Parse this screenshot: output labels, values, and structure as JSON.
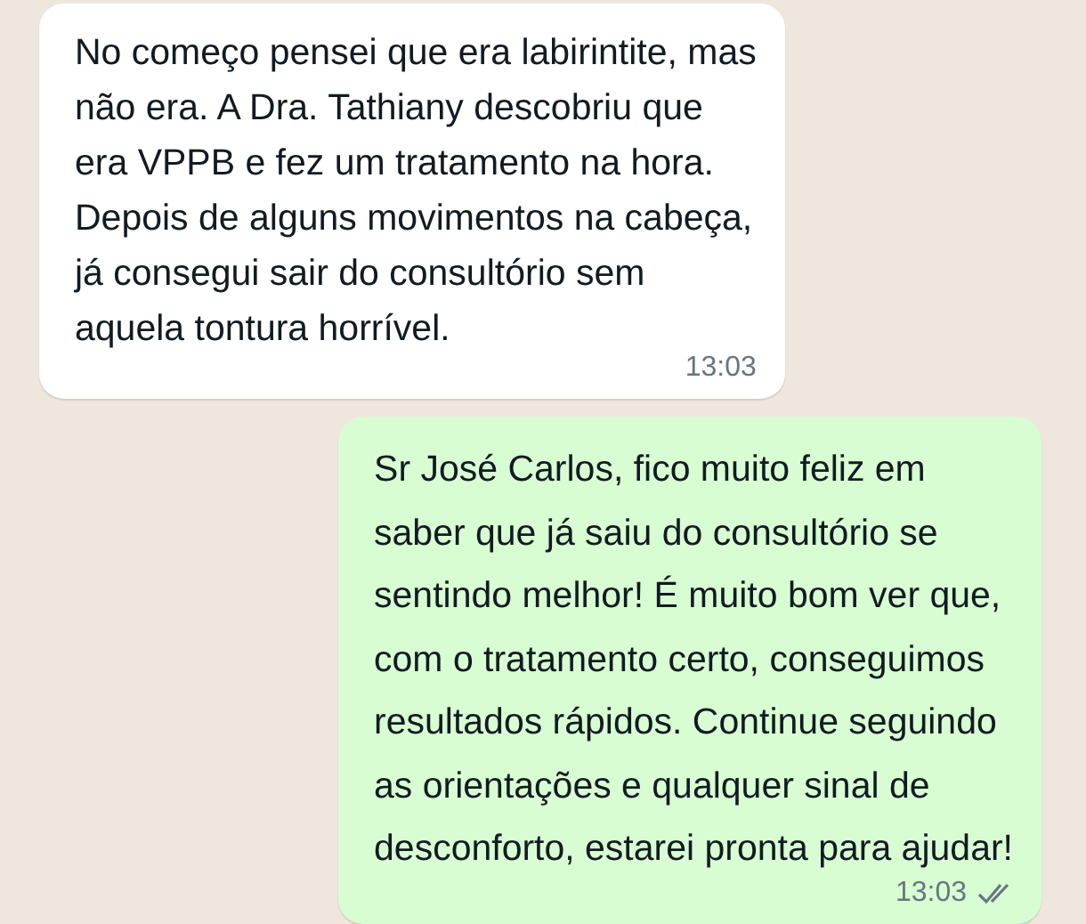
{
  "messages": [
    {
      "kind": "incoming",
      "text": "No começo pensei que era labirintite, mas\nnão era. A Dra. Tathiany descobriu que\nera VPPB e fez um tratamento na hora.\nDepois de alguns movimentos na cabeça,\njá consegui sair do consultório sem\naquela tontura horrível.",
      "time": "13:03"
    },
    {
      "kind": "outgoing",
      "text": "Sr José Carlos, fico muito feliz em\nsaber que já saiu do consultório se\nsentindo melhor! É muito bom ver que,\ncom o tratamento certo, conseguimos\nresultados rápidos. Continue seguindo\nas orientações e qualquer sinal de\ndesconforto, estarei pronta para ajudar!",
      "time": "13:03",
      "read": false
    }
  ]
}
